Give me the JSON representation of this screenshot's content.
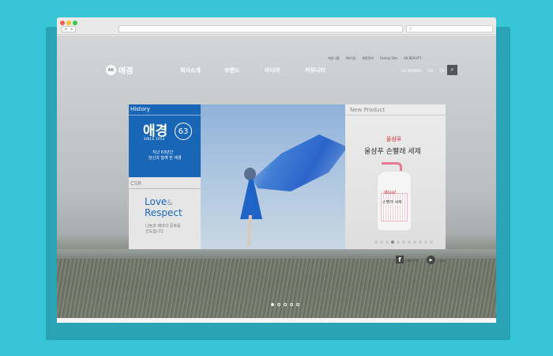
{
  "browser": {
    "back_glyph": "◂",
    "forward_glyph": "▸",
    "search_glyph": "⌕"
  },
  "utility_nav": [
    "애경그룹",
    "AK기업",
    "채용정보",
    "Family Site",
    "AK BEAUTY"
  ],
  "header": {
    "logo_mark": "AK",
    "logo_text": "애경",
    "menu": [
      "회사소개",
      "브랜드",
      "미디어",
      "커뮤니티"
    ],
    "right_links": [
      "ALL BRANDS",
      "EN",
      "CN"
    ],
    "search_icon": "⌕"
  },
  "panels": {
    "history": {
      "tag": "History",
      "brand": "애경",
      "years": "63",
      "since": "SINCE 1954",
      "subtitle_line1": "지난 63년간",
      "subtitle_line2": "당신과 함께 한 애경"
    },
    "csr": {
      "tag": "CSR",
      "love": "Love",
      "amp": "&",
      "respect": "Respect",
      "subtitle_line1": "나눔과 배려의 문화를",
      "subtitle_line2": "선도합니다"
    },
    "product": {
      "tag": "New Product",
      "title_red": "울샴푸",
      "title": "울샴푸 손빨래 세제",
      "bottle_brand": "Wool",
      "bottle_name": "손빨래 세제"
    }
  },
  "social": {
    "facebook_label": "페이스북",
    "play_label": "광고"
  },
  "colors": {
    "background": "#39c5d8",
    "accent_blue": "#1a66b6",
    "product_red": "#d0303d"
  }
}
